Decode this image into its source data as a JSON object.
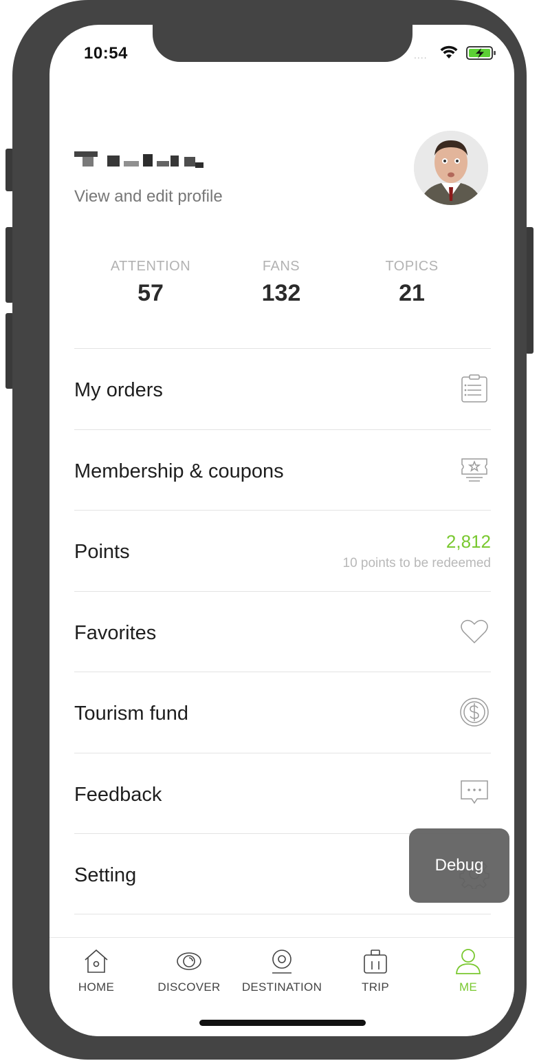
{
  "status_bar": {
    "time": "10:54",
    "signal_dots": "....",
    "wifi_icon": "wifi-icon",
    "battery_icon": "battery-charging-icon"
  },
  "profile": {
    "edit_link": "View and edit profile",
    "avatar_icon": "user-avatar-photo"
  },
  "stats": [
    {
      "label": "ATTENTION",
      "value": "57"
    },
    {
      "label": "FANS",
      "value": "132"
    },
    {
      "label": "TOPICS",
      "value": "21"
    }
  ],
  "menu": {
    "orders": {
      "label": "My orders",
      "icon": "clipboard-icon"
    },
    "membership": {
      "label": "Membership & coupons",
      "icon": "ticket-icon"
    },
    "points": {
      "label": "Points",
      "value": "2,812",
      "subtext": "10 points to be redeemed"
    },
    "favorites": {
      "label": "Favorites",
      "icon": "heart-icon"
    },
    "fund": {
      "label": "Tourism fund",
      "icon": "dollar-coin-icon"
    },
    "feedback": {
      "label": "Feedback",
      "icon": "chat-bubble-icon"
    },
    "setting": {
      "label": "Setting",
      "icon": "gear-icon"
    }
  },
  "debug": {
    "label": "Debug"
  },
  "tabbar": {
    "home": {
      "label": "HOME",
      "icon": "home-icon"
    },
    "discover": {
      "label": "DISCOVER",
      "icon": "eye-icon"
    },
    "destination": {
      "label": "DESTINATION",
      "icon": "location-pin-icon"
    },
    "trip": {
      "label": "TRIP",
      "icon": "luggage-icon"
    },
    "me": {
      "label": "ME",
      "icon": "person-icon",
      "active": true
    }
  },
  "colors": {
    "accent": "#79c82f",
    "frame": "#444444",
    "text": "#1e1e1e",
    "muted": "#b2b2b2",
    "divider": "#e3e3e3"
  }
}
